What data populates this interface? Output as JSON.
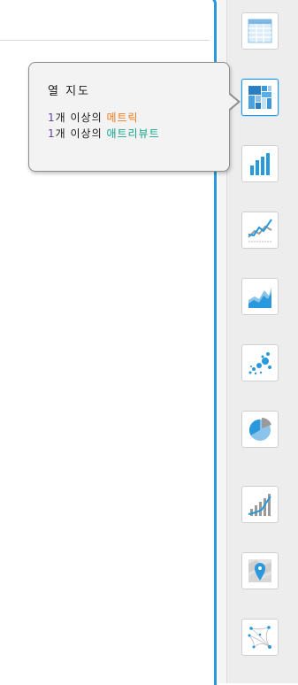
{
  "tooltip": {
    "title": "열 지도",
    "line1": {
      "count": "1",
      "text": "개 이상의 ",
      "highlight": "메트릭"
    },
    "line2": {
      "count": "1",
      "text": "개 이상의 ",
      "highlight": "애트리뷰트"
    }
  },
  "colors": {
    "accent_blue": "#2a98dc",
    "metric_orange": "#f07a18",
    "attribute_teal": "#12a58c",
    "count_purple": "#6b3fa0"
  },
  "sidebar": {
    "selected": "heat-map",
    "items": [
      {
        "id": "grid",
        "icon": "grid-table-icon"
      },
      {
        "id": "heat-map",
        "icon": "heat-map-icon"
      },
      {
        "id": "bar-chart",
        "icon": "bar-chart-icon"
      },
      {
        "id": "line-chart",
        "icon": "line-chart-icon"
      },
      {
        "id": "area-chart",
        "icon": "area-chart-icon"
      },
      {
        "id": "bubble-chart",
        "icon": "bubble-chart-icon"
      },
      {
        "id": "pie-chart",
        "icon": "pie-chart-icon"
      },
      {
        "id": "combo-chart",
        "icon": "combo-chart-icon"
      },
      {
        "id": "map",
        "icon": "map-pin-icon"
      },
      {
        "id": "network",
        "icon": "network-icon"
      }
    ]
  }
}
